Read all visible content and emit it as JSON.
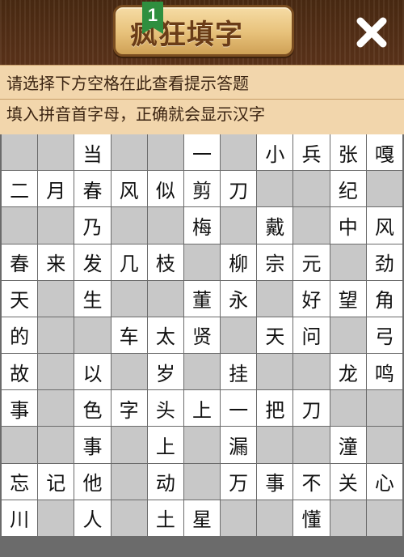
{
  "header": {
    "title": "疯狂填字",
    "level": "1",
    "close_icon": "close-icon"
  },
  "hints": {
    "line1": "请选择下方空格在此查看提示答题",
    "line2": "填入拼音首字母，正确就会显示汉字"
  },
  "grid": {
    "rows": [
      [
        "",
        "",
        "当",
        "",
        "",
        "一",
        "",
        "小",
        "兵",
        "张",
        "嘎"
      ],
      [
        "二",
        "月",
        "春",
        "风",
        "似",
        "剪",
        "刀",
        "",
        "",
        "纪",
        ""
      ],
      [
        "",
        "",
        "乃",
        "",
        "",
        "梅",
        "",
        "戴",
        "",
        "中",
        "风"
      ],
      [
        "春",
        "来",
        "发",
        "几",
        "枝",
        "",
        "柳",
        "宗",
        "元",
        "",
        "劲"
      ],
      [
        "天",
        "",
        "生",
        "",
        "",
        "董",
        "永",
        "",
        "好",
        "望",
        "角"
      ],
      [
        "的",
        "",
        "",
        "车",
        "太",
        "贤",
        "",
        "天",
        "问",
        "",
        "弓"
      ],
      [
        "故",
        "",
        "以",
        "",
        "岁",
        "",
        "挂",
        "",
        "",
        "龙",
        "鸣"
      ],
      [
        "事",
        "",
        "色",
        "字",
        "头",
        "上",
        "一",
        "把",
        "刀",
        "",
        ""
      ],
      [
        "",
        "",
        "事",
        "",
        "上",
        "",
        "漏",
        "",
        "",
        "潼",
        ""
      ],
      [
        "忘",
        "记",
        "他",
        "",
        "动",
        "",
        "万",
        "事",
        "不",
        "关",
        "心"
      ],
      [
        "川",
        "",
        "人",
        "",
        "土",
        "星",
        "",
        "",
        "懂",
        "",
        ""
      ]
    ]
  },
  "colors": {
    "wood_dark": "#4a2a12",
    "badge_gold": "#e7c17a",
    "hint_bg": "#f2d6ac",
    "empty_cell": "#c8c8c8",
    "ribbon_green": "#2f8f3f"
  }
}
